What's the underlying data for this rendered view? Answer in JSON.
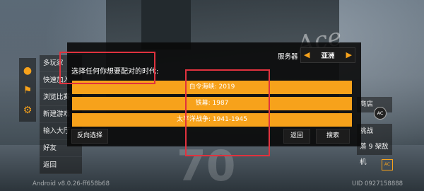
{
  "dialog": {
    "prompt": "选择任何你想要配对的时代:",
    "server_label": "服务器",
    "server_value": "亚洲",
    "options": [
      "白令海峡: 2019",
      "铁幕: 1987",
      "太平洋战争: 1941-1945"
    ],
    "reverse_label": "反向选择",
    "back_label": "返回",
    "search_label": "搜索"
  },
  "side_menu": {
    "items": [
      "多玩家",
      "快速加入",
      "浏览比赛",
      "新建游戏",
      "输入大厅",
      "好友",
      "返回"
    ]
  },
  "right_menu": {
    "items": [
      "商店",
      "挑战",
      "落 9 架敌机"
    ],
    "badge": "AC",
    "badge2": "AC"
  },
  "footer": {
    "version": "Android v8.0.26-ff658b68",
    "uid": "UID 0927158888"
  },
  "background": {
    "scrawl": "Ace"
  },
  "colors": {
    "accent": "#f7a21b",
    "dialog_bg": "#0a0a0a",
    "annotation": "#e0323e"
  }
}
